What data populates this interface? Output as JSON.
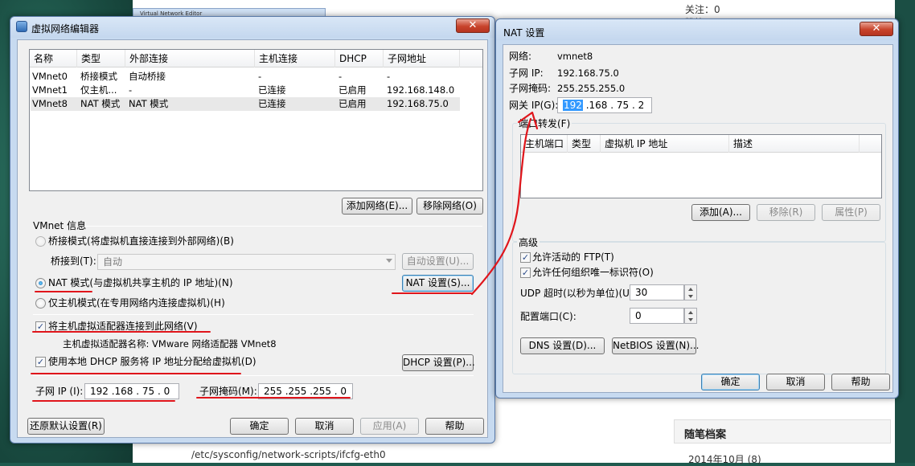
{
  "background": {
    "sidebar_follow": "关注：0",
    "sidebar_fans": "粉丝",
    "ghost_title": "Virtual Network Editor",
    "path_text": "/etc/sysconfig/network-scripts/ifcfg-eth0",
    "archive_title": "随笔档案",
    "archive_item": "2014年10月 (8)"
  },
  "vne": {
    "title": "虚拟网络编辑器",
    "close": "✕",
    "columns": [
      "名称",
      "类型",
      "外部连接",
      "主机连接",
      "DHCP",
      "子网地址"
    ],
    "rows": [
      [
        "VMnet0",
        "桥接模式",
        "自动桥接",
        "-",
        "-",
        "-"
      ],
      [
        "VMnet1",
        "仅主机...",
        "-",
        "已连接",
        "已启用",
        "192.168.148.0"
      ],
      [
        "VMnet8",
        "NAT 模式",
        "NAT 模式",
        "已连接",
        "已启用",
        "192.168.75.0"
      ]
    ],
    "add_network": "添加网络(E)...",
    "remove_network": "移除网络(O)",
    "info_title": "VMnet 信息",
    "bridge_mode": "桥接模式(将虚拟机直接连接到外部网络)(B)",
    "bridge_to_label": "桥接到(T):",
    "bridge_to_value": "自动",
    "auto_settings": "自动设置(U)...",
    "nat_mode": "NAT 模式(与虚拟机共享主机的 IP 地址)(N)",
    "nat_settings": "NAT 设置(S)...",
    "host_only": "仅主机模式(在专用网络内连接虚拟机)(H)",
    "connect_adapter": "将主机虚拟适配器连接到此网络(V)",
    "adapter_name": "主机虚拟适配器名称: VMware 网络适配器 VMnet8",
    "use_dhcp": "使用本地 DHCP 服务将 IP 地址分配给虚拟机(D)",
    "dhcp_settings": "DHCP 设置(P)...",
    "subnet_ip_label": "子网 IP (I):",
    "subnet_ip": "192 .168 . 75  .  0",
    "subnet_mask_label": "子网掩码(M):",
    "subnet_mask": "255 .255 .255 .  0",
    "restore": "还原默认设置(R)",
    "ok": "确定",
    "cancel": "取消",
    "apply": "应用(A)",
    "help": "帮助"
  },
  "nat": {
    "title": "NAT 设置",
    "close": "✕",
    "network_label": "网络:",
    "network_value": "vmnet8",
    "subnet_ip_label": "子网 IP:",
    "subnet_ip_value": "192.168.75.0",
    "subnet_mask_label": "子网掩码:",
    "subnet_mask_value": "255.255.255.0",
    "gateway_label": "网关 IP(G):",
    "gateway_sel": "192",
    "gateway_rest": " .168 . 75  .  2",
    "port_forward_title": "端口转发(F)",
    "pf_columns": [
      "主机端口",
      "类型",
      "虚拟机 IP 地址",
      "描述"
    ],
    "add": "添加(A)...",
    "remove": "移除(R)",
    "properties": "属性(P)",
    "advanced_title": "高级",
    "allow_ftp": "允许活动的 FTP(T)",
    "allow_oui": "允许任何组织唯一标识符(O)",
    "udp_label": "UDP 超时(以秒为单位)(U):",
    "udp_value": "30",
    "config_port_label": "配置端口(C):",
    "config_port_value": "0",
    "dns_settings": "DNS 设置(D)...",
    "netbios_settings": "NetBIOS 设置(N)...",
    "ok": "确定",
    "cancel": "取消",
    "help": "帮助"
  },
  "check_mark": "✓",
  "colors": {
    "annotation_red": "#e0151b",
    "window_frame": "#c7daf0",
    "selection": "#3399ff"
  }
}
